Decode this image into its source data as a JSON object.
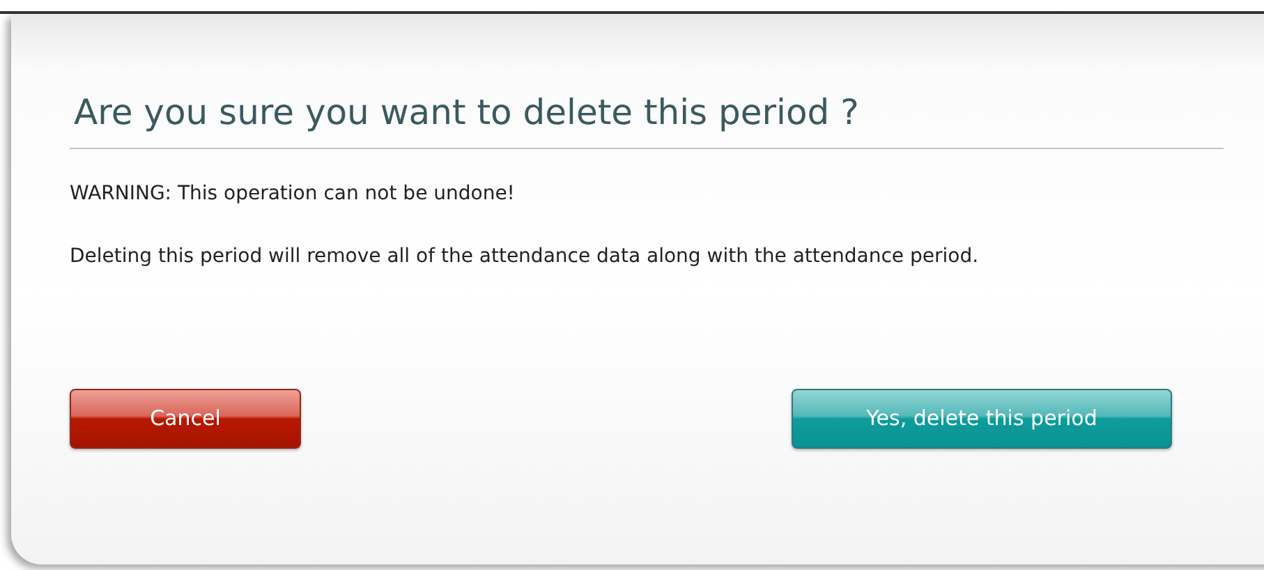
{
  "dialog": {
    "title": "Are you sure you want to delete this period ?",
    "warning": "WARNING: This operation can not be undone!",
    "message": "Deleting this period will remove all of the attendance data along with the attendance period.",
    "buttons": [
      {
        "label": "Cancel",
        "kind": "cancel"
      },
      {
        "label": "Yes, delete this period",
        "kind": "confirm"
      }
    ]
  }
}
